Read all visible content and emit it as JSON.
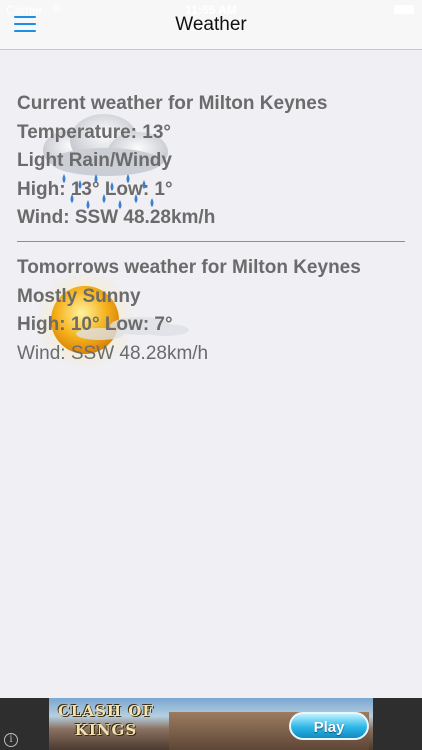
{
  "status_bar": {
    "carrier": "Carrier",
    "wifi_icon": "wifi-icon",
    "time": "11:55 AM",
    "battery_icon": "battery-icon"
  },
  "nav": {
    "title": "Weather",
    "menu_icon": "hamburger-menu-icon",
    "accent_color": "#1a8fe3"
  },
  "current": {
    "heading": "Current weather for Milton Keynes",
    "temperature": "Temperature: 13°",
    "condition": "Light Rain/Windy",
    "high_low": "High: 13° Low: 1°",
    "wind": "Wind: SSW 48.28km/h",
    "icon": "rain-cloud-icon"
  },
  "tomorrow": {
    "heading": "Tomorrows weather for Milton Keynes",
    "condition": "Mostly Sunny",
    "high_low": "High: 10° Low: 7°",
    "wind": "Wind: SSW 48.28km/h",
    "icon": "sun-cloud-icon"
  },
  "ad": {
    "title": "CLASH OF KINGS",
    "button": "Play",
    "info_icon": "info-icon",
    "info_glyph": "i"
  }
}
